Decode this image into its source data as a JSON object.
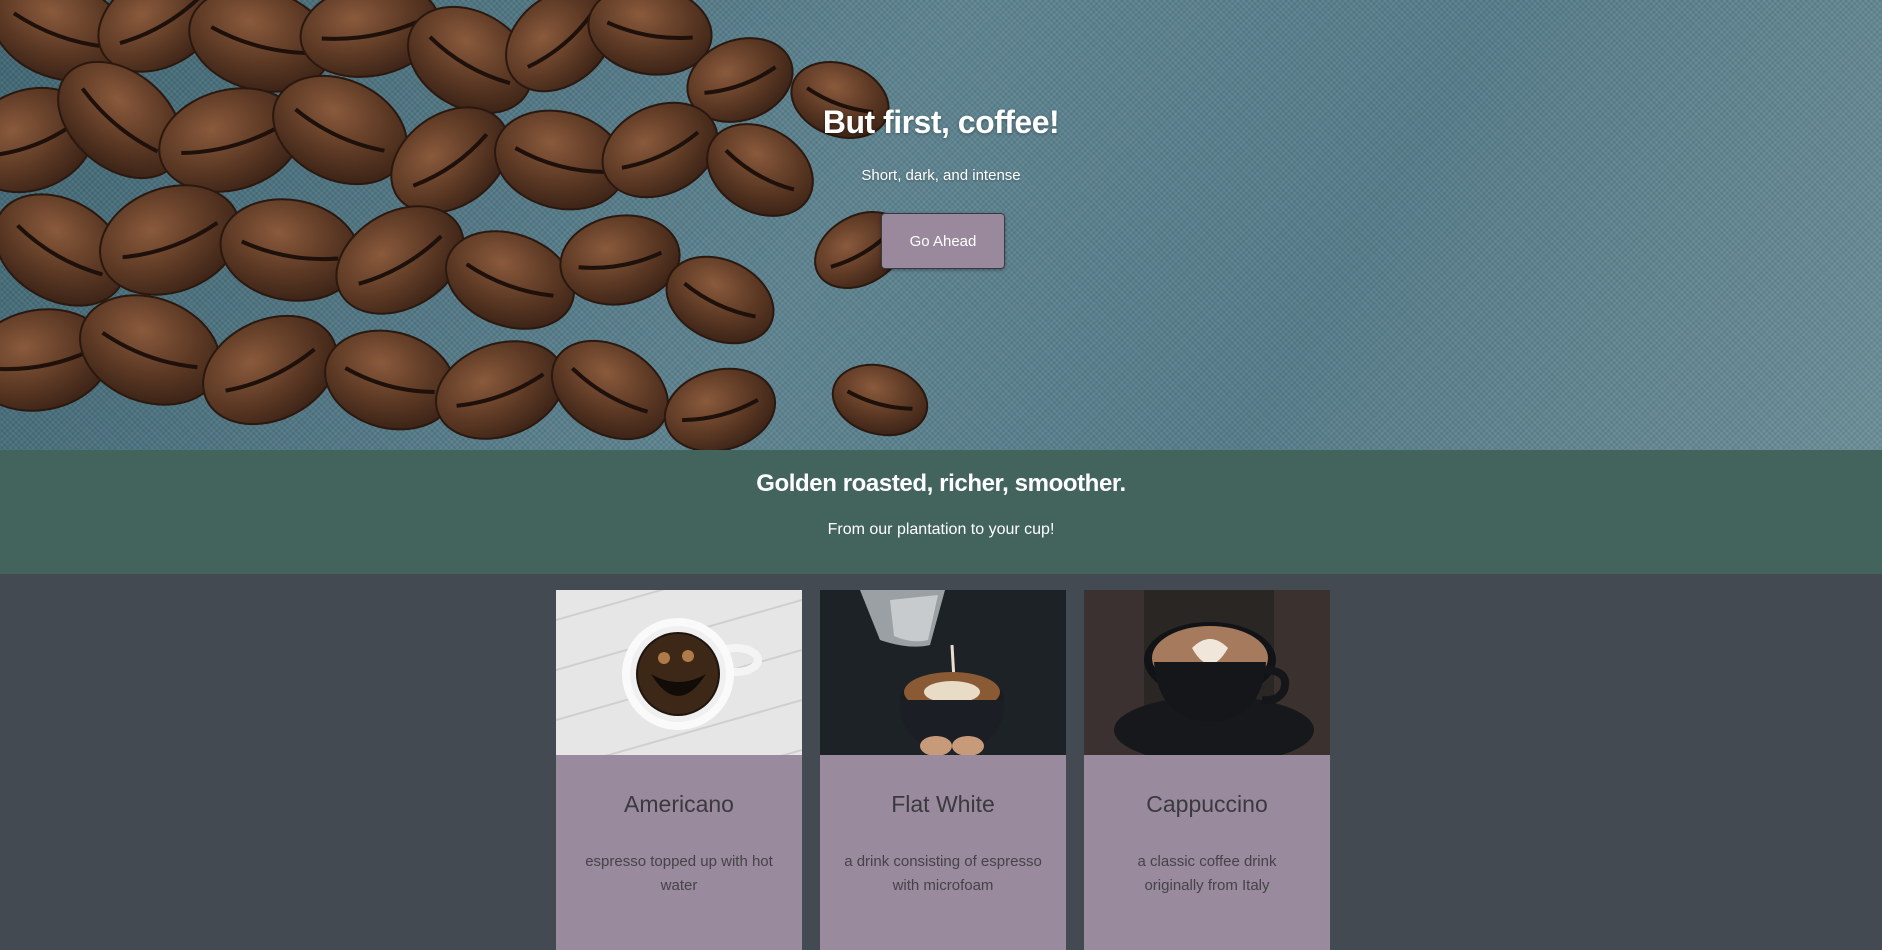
{
  "hero": {
    "title": "But first, coffee!",
    "subtitle": "Short, dark, and intense",
    "button_label": "Go Ahead"
  },
  "band": {
    "title": "Golden roasted, richer, smoother.",
    "subtitle": "From our plantation to your cup!"
  },
  "cards": [
    {
      "title": "Americano",
      "description": "espresso topped up with hot water"
    },
    {
      "title": "Flat White",
      "description": "a drink consisting of espresso with microfoam"
    },
    {
      "title": "Cappuccino",
      "description": "a classic coffee drink originally from Italy"
    }
  ],
  "colors": {
    "hero_bg": "#557c89",
    "button": "#9a889c",
    "band": "#43645c",
    "page_bg": "#444a52",
    "card_bg": "#998a9d"
  }
}
